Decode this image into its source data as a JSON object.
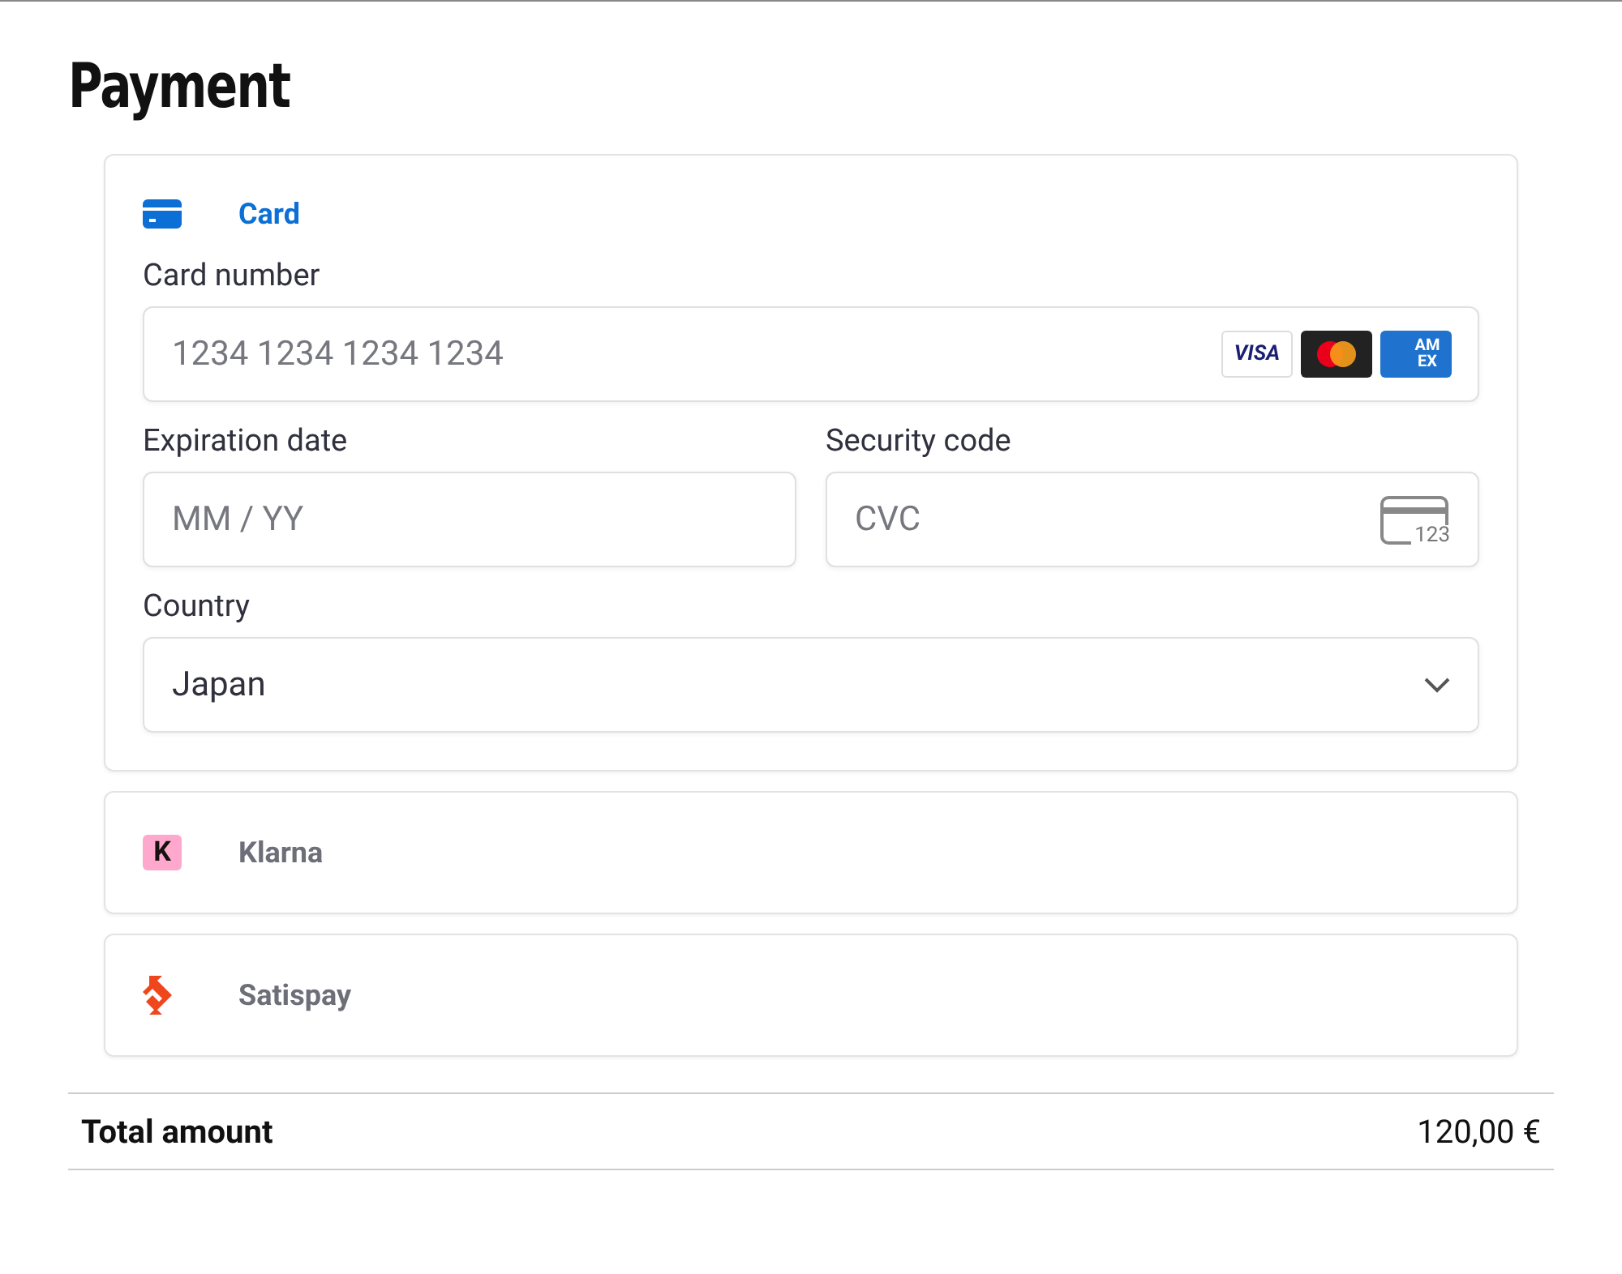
{
  "title": "Payment",
  "methods": [
    {
      "kind": "card",
      "label": "Card",
      "selected": true
    },
    {
      "kind": "klarna",
      "label": "Klarna",
      "logo_text": "K",
      "selected": false
    },
    {
      "kind": "satispay",
      "label": "Satispay",
      "selected": false
    }
  ],
  "card_form": {
    "card_number": {
      "label": "Card number",
      "placeholder": "1234 1234 1234 1234",
      "brands": [
        {
          "kind": "visa",
          "text": "VISA"
        },
        {
          "kind": "mastercard"
        },
        {
          "kind": "amex",
          "text": "AM EX"
        }
      ]
    },
    "expiration": {
      "label": "Expiration date",
      "placeholder": "MM / YY"
    },
    "security": {
      "label": "Security code",
      "placeholder": "CVC",
      "icon_text": "123"
    },
    "country": {
      "label": "Country",
      "value": "Japan"
    }
  },
  "total": {
    "label": "Total amount",
    "value": "120,00 €"
  }
}
